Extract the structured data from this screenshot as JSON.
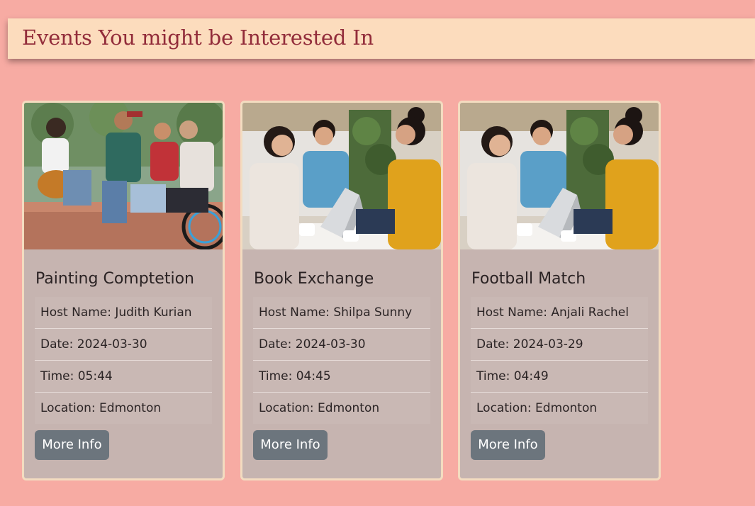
{
  "page": {
    "title": "Events You might be Interested In"
  },
  "events": [
    {
      "title": "Painting Comptetion",
      "host": "Host Name: Judith Kurian",
      "date": "Date: 2024-03-30",
      "time": "Time: 05:44",
      "location": "Location: Edmonton",
      "button_label": "More Info"
    },
    {
      "title": "Book Exchange",
      "host": "Host Name: Shilpa Sunny",
      "date": "Date: 2024-03-30",
      "time": "Time: 04:45",
      "location": "Location: Edmonton",
      "button_label": "More Info"
    },
    {
      "title": "Football Match",
      "host": "Host Name: Anjali Rachel",
      "date": "Date: 2024-03-29",
      "time": "Time: 04:49",
      "location": "Location: Edmonton",
      "button_label": "More Info"
    }
  ],
  "colors": {
    "background": "#f7aba3",
    "header_bg": "#fcdcbd",
    "header_text": "#922c3a",
    "card_bg": "#c6b4b0",
    "card_border": "#f3dcc0",
    "button_bg": "#6c757d"
  }
}
